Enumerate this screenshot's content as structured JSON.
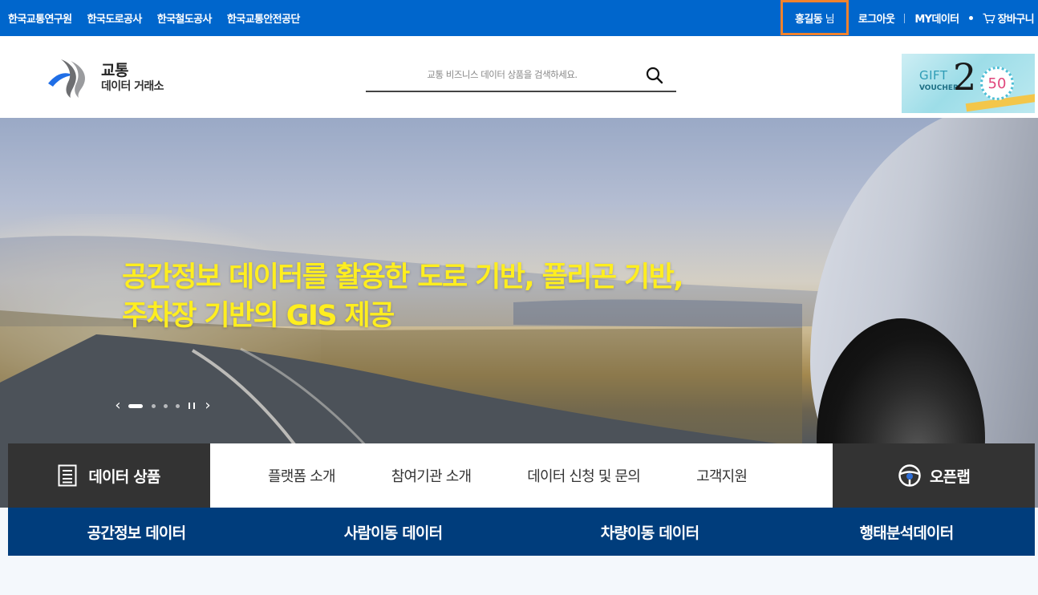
{
  "topbar": {
    "orgs": [
      "한국교통연구원",
      "한국도로공사",
      "한국철도공사",
      "한국교통안전공단"
    ],
    "user_name": "홍길동",
    "user_suffix": "님",
    "logout": "로그아웃",
    "my_data": "MY데이터",
    "cart": "장바구니"
  },
  "header": {
    "logo_line1": "교통",
    "logo_line2": "데이터 거래소",
    "search_placeholder": "교통 비즈니스 데이터 상품을 검색하세요.",
    "voucher": {
      "gift": "GIFT",
      "voucher": "VOUCHER",
      "big_number": "2",
      "stamp": "50"
    }
  },
  "hero": {
    "headline_line1": "공간정보 데이터를 활용한 도로 기반, 폴리곤 기반,",
    "headline_line2": "주차장 기반의 GIS 제공",
    "prev": "‹",
    "next": "›"
  },
  "nav": {
    "products": "데이터 상품",
    "menu": [
      "플랫폼 소개",
      "참여기관 소개",
      "데이터 신청 및 문의",
      "고객지원"
    ],
    "openlab": "오픈랩"
  },
  "categories": [
    "공간정보 데이터",
    "사람이동 데이터",
    "차량이동 데이터",
    "행태분석데이터"
  ],
  "colors": {
    "topbar": "#0066cc",
    "highlight": "#f0822d",
    "headline": "#ffee1f",
    "dark_tab": "#333333",
    "category_bar": "#003d7c"
  }
}
